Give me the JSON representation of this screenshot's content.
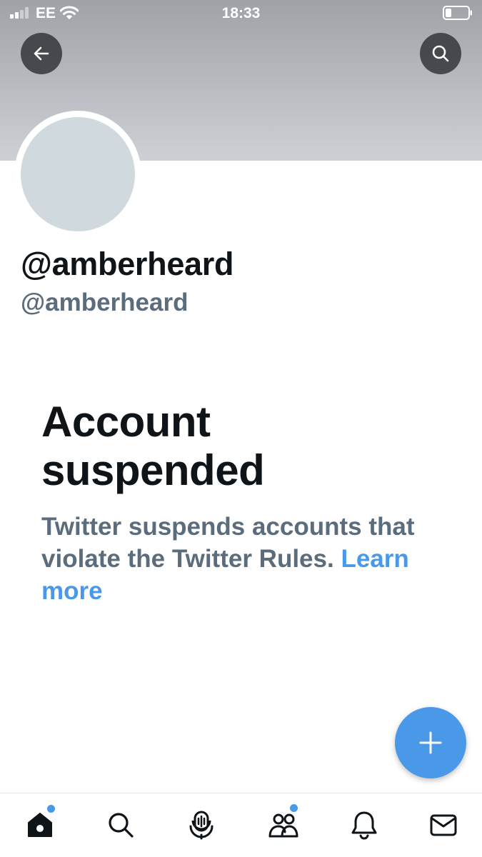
{
  "status_bar": {
    "carrier": "EE",
    "time": "18:33",
    "icons": [
      "cellular-signal-icon",
      "wifi-icon",
      "battery-icon"
    ]
  },
  "header": {
    "back_icon": "arrow-left-icon",
    "search_icon": "search-icon"
  },
  "profile": {
    "display_name": "@amberheard",
    "handle": "@amberheard"
  },
  "suspension": {
    "title_line1": "Account",
    "title_line2": "suspended",
    "message": "Twitter suspends accounts that violate the Twitter Rules. ",
    "link_label": "Learn more"
  },
  "fab": {
    "icon": "plus-icon"
  },
  "tab_bar": {
    "items": [
      {
        "name": "home",
        "icon": "home-icon",
        "active": true,
        "badge": true
      },
      {
        "name": "search",
        "icon": "search-icon",
        "active": false,
        "badge": false
      },
      {
        "name": "spaces",
        "icon": "microphone-icon",
        "active": false,
        "badge": false
      },
      {
        "name": "communities",
        "icon": "people-icon",
        "active": false,
        "badge": true
      },
      {
        "name": "notifications",
        "icon": "bell-icon",
        "active": false,
        "badge": false
      },
      {
        "name": "messages",
        "icon": "envelope-icon",
        "active": false,
        "badge": false
      }
    ]
  },
  "colors": {
    "accent": "#4a99e9",
    "text_primary": "#0f1419",
    "text_secondary": "#5b6d7c",
    "avatar_placeholder": "#cfd9de",
    "badge": "#4a99e9"
  }
}
